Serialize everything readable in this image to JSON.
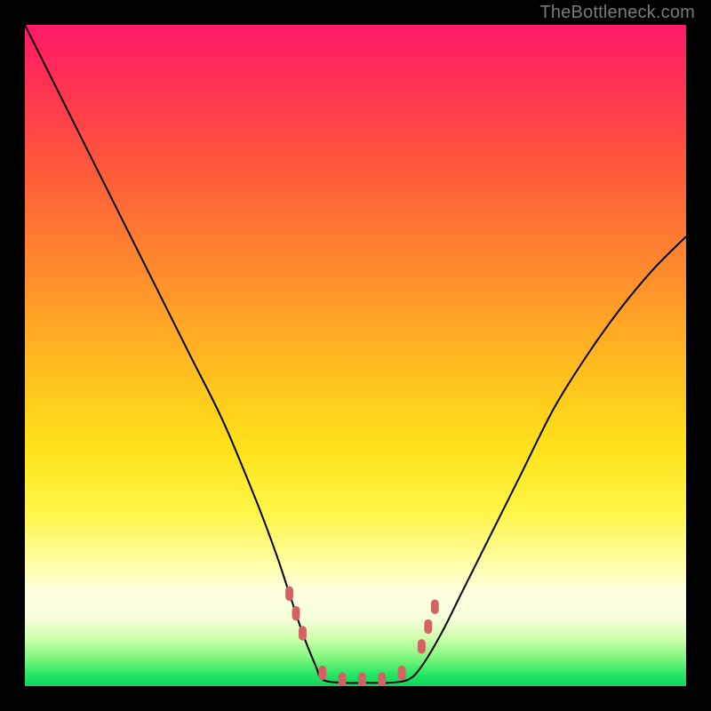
{
  "attribution": "TheBottleneck.com",
  "colors": {
    "frame": "#000000",
    "curve": "#000000",
    "markers": "#d56262",
    "gradient_top": "#ff1a6b",
    "gradient_mid": "#ffe21a",
    "gradient_bottom": "#15d45e"
  },
  "chart_data": {
    "type": "line",
    "title": "",
    "xlabel": "",
    "ylabel": "",
    "xlim": [
      0,
      100
    ],
    "ylim": [
      0,
      100
    ],
    "grid": false,
    "legend": false,
    "description": "V-shaped bottleneck curve overlaid on a vertical heat gradient; low values near the bottom center, high values near the left and right top edges.",
    "series": [
      {
        "name": "left-branch",
        "x": [
          0,
          5,
          10,
          15,
          20,
          25,
          30,
          35,
          38,
          40,
          42,
          44,
          45
        ],
        "y": [
          100,
          90,
          80,
          70,
          60,
          50,
          40,
          28,
          20,
          14,
          8,
          3,
          1
        ]
      },
      {
        "name": "flat-bottom",
        "x": [
          45,
          48,
          52,
          55,
          58
        ],
        "y": [
          1,
          0.5,
          0.5,
          0.5,
          1
        ]
      },
      {
        "name": "right-branch",
        "x": [
          58,
          60,
          63,
          66,
          70,
          75,
          80,
          85,
          90,
          95,
          100
        ],
        "y": [
          1,
          3,
          8,
          14,
          22,
          32,
          42,
          50,
          57,
          63,
          68
        ]
      }
    ],
    "markers": {
      "name": "pink-dots",
      "description": "Short dash-like pink markers near the valley of the curve.",
      "points": [
        {
          "x": 40,
          "y": 14
        },
        {
          "x": 41,
          "y": 11
        },
        {
          "x": 42,
          "y": 8
        },
        {
          "x": 45,
          "y": 2
        },
        {
          "x": 48,
          "y": 1
        },
        {
          "x": 51,
          "y": 1
        },
        {
          "x": 54,
          "y": 1
        },
        {
          "x": 57,
          "y": 2
        },
        {
          "x": 60,
          "y": 6
        },
        {
          "x": 61,
          "y": 9
        },
        {
          "x": 62,
          "y": 12
        }
      ]
    }
  }
}
